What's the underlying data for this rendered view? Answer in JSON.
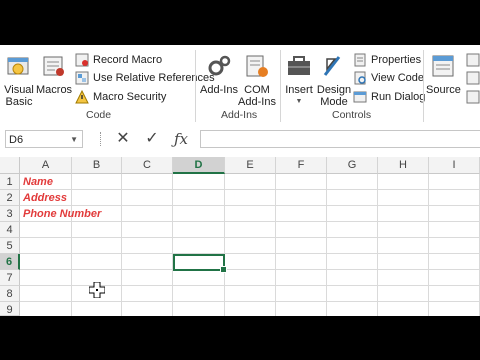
{
  "ribbon": {
    "code": {
      "visual_basic": "Visual\nBasic",
      "macros": "Macros",
      "record_macro": "Record Macro",
      "relative_refs": "Use Relative References",
      "macro_security": "Macro Security",
      "label": "Code"
    },
    "addins": {
      "addins": "Add-Ins",
      "com_addins": "COM\nAdd-Ins",
      "label": "Add-Ins"
    },
    "controls": {
      "insert": "Insert",
      "design_mode": "Design\nMode",
      "properties": "Properties",
      "view_code": "View Code",
      "run_dialog": "Run Dialog",
      "label": "Controls"
    },
    "xml": {
      "source": "Source"
    }
  },
  "formula_bar": {
    "name_box": "D6",
    "formula": ""
  },
  "sheet": {
    "columns": [
      "A",
      "B",
      "C",
      "D",
      "E",
      "F",
      "G",
      "H",
      "I"
    ],
    "rows": [
      "1",
      "2",
      "3",
      "4",
      "5",
      "6",
      "7",
      "8",
      "9"
    ],
    "selected_column": "D",
    "selected_row": "6",
    "cells": {
      "A1": "Name",
      "A2": "Address",
      "A3": "Phone Number"
    }
  },
  "colors": {
    "accent": "#217346",
    "cell_text": "#e23b3b"
  }
}
